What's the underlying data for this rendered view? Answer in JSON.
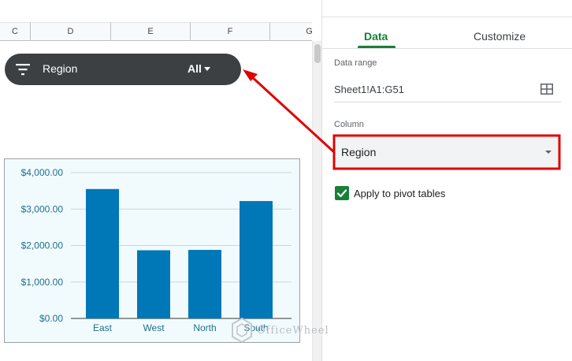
{
  "sheet": {
    "columns": [
      "C",
      "D",
      "E",
      "F",
      "G"
    ]
  },
  "filter": {
    "label": "Region",
    "value": "All",
    "icon": "filter-icon"
  },
  "chart_data": {
    "type": "bar",
    "categories": [
      "East",
      "West",
      "North",
      "South"
    ],
    "values": [
      3550,
      1870,
      1880,
      3220
    ],
    "yticks": [
      "$0.00",
      "$1,000.00",
      "$2,000.00",
      "$3,000.00",
      "$4,000.00"
    ],
    "ylim": [
      0,
      4000
    ],
    "grid": true,
    "colors": {
      "bar": "#0077b6",
      "background": "#f1fbfe",
      "tick": "#1f6e8c"
    }
  },
  "panel": {
    "tabs": [
      "Data",
      "Customize"
    ],
    "active_tab": "Data",
    "data_range_label": "Data range",
    "data_range_value": "Sheet1!A1:G51",
    "column_label": "Column",
    "column_value": "Region",
    "apply_pivot_label": "Apply to pivot tables",
    "apply_pivot_checked": true,
    "accent_color": "#188038"
  },
  "annotation": {
    "color": "#e00000"
  },
  "watermark": "OfficeWheel"
}
